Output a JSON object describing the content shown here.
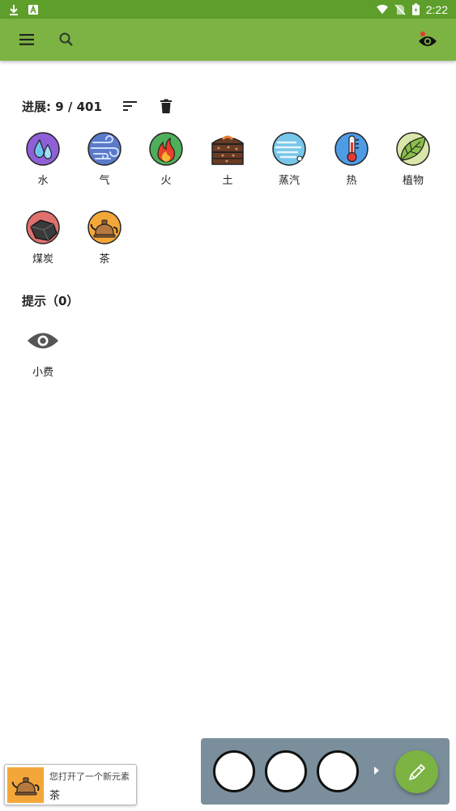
{
  "status_bar": {
    "time": "2:22",
    "left_icons": [
      "download-icon",
      "app-notification-icon"
    ],
    "right_icons": [
      "wifi-icon",
      "no-sim-icon",
      "battery-charging-icon"
    ]
  },
  "app_bar": {
    "color": "#7cb342",
    "icons": [
      "menu-icon",
      "search-icon",
      "eye-icon"
    ],
    "eye_badge_color": "#e53935"
  },
  "progress": {
    "label": "进展: 9 / 401",
    "tools": [
      "sort-icon",
      "delete-icon"
    ]
  },
  "elements": [
    {
      "name": "水",
      "icon": "water-drop-icon"
    },
    {
      "name": "气",
      "icon": "wind-icon"
    },
    {
      "name": "火",
      "icon": "fire-icon"
    },
    {
      "name": "土",
      "icon": "earth-icon"
    },
    {
      "name": "蒸汽",
      "icon": "steam-icon"
    },
    {
      "name": "热",
      "icon": "thermometer-icon"
    },
    {
      "name": "植物",
      "icon": "leaf-icon"
    },
    {
      "name": "煤炭",
      "icon": "coal-icon"
    },
    {
      "name": "茶",
      "icon": "teapot-icon"
    }
  ],
  "hints": {
    "title": "提示（0）",
    "items": [
      {
        "name": "小费",
        "icon": "eye-icon"
      }
    ]
  },
  "toast": {
    "message": "您打开了一个新元素",
    "element_name": "茶",
    "icon": "teapot-icon"
  },
  "combine_bar": {
    "slots": 3,
    "fab_icon": "pencil-icon",
    "bar_color": "#7a8f9b"
  }
}
